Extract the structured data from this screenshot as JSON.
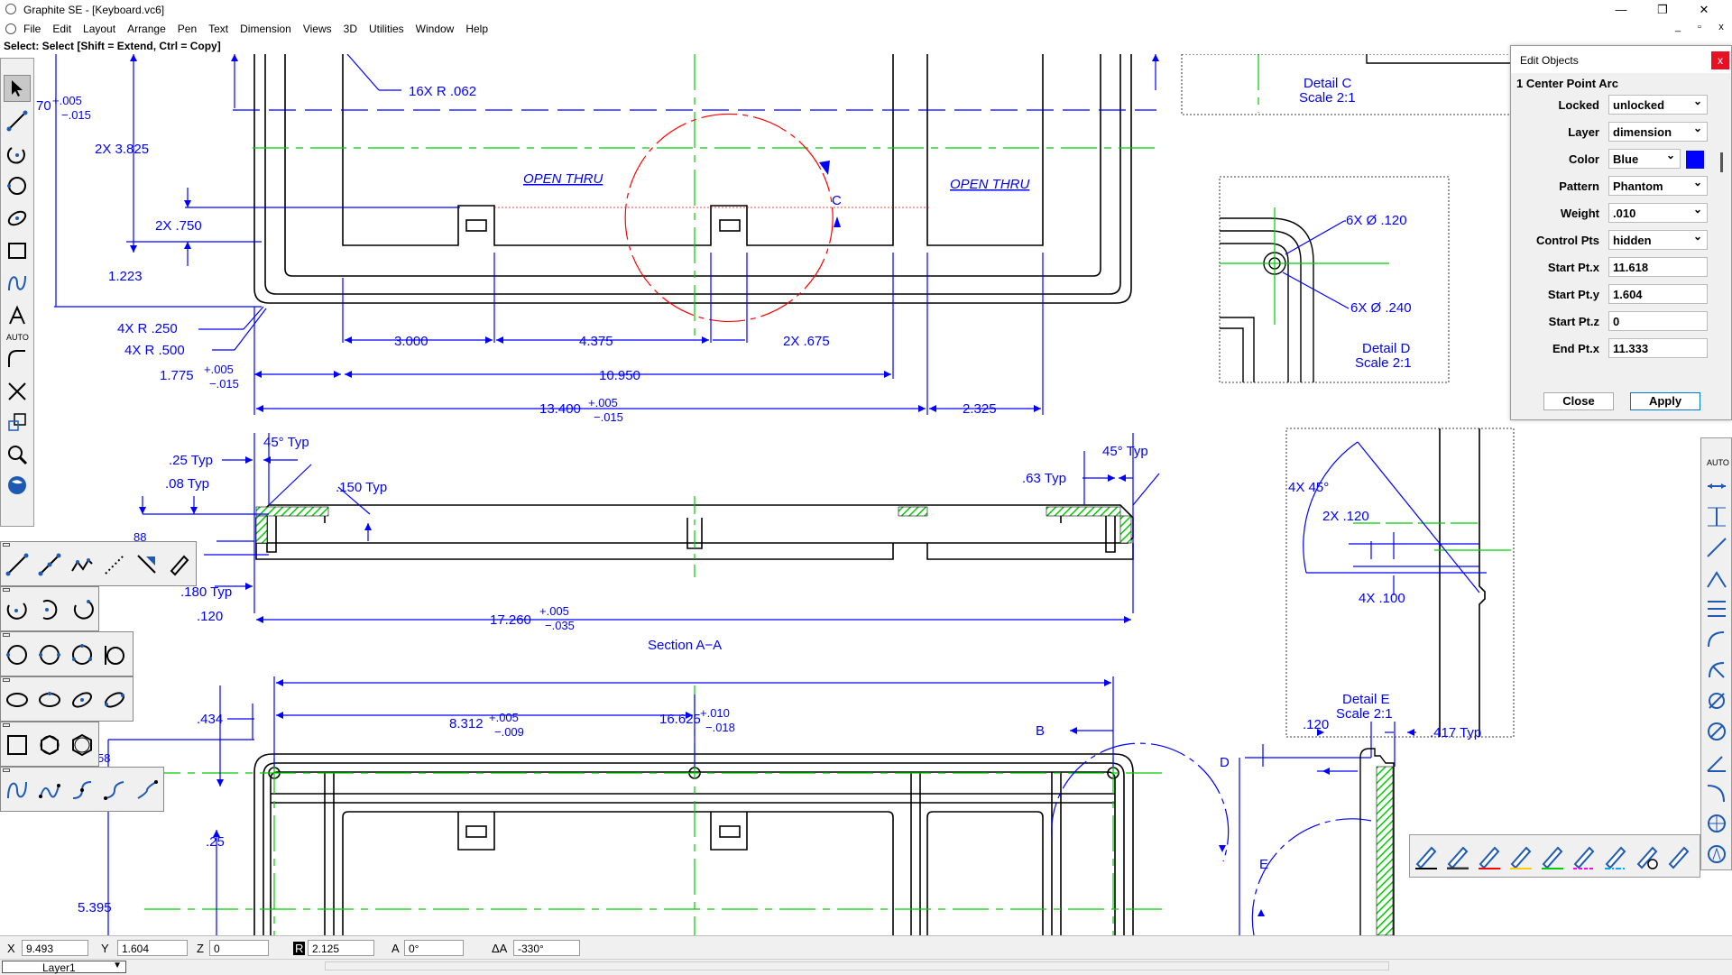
{
  "window": {
    "title": "Graphite SE - [Keyboard.vc6]",
    "minimize": "—",
    "maximize": "❐",
    "close": "✕",
    "doc_minimize": "_",
    "doc_restore": "▫",
    "doc_close": "x"
  },
  "menu": [
    "File",
    "Edit",
    "Layout",
    "Arrange",
    "Pen",
    "Text",
    "Dimension",
    "Views",
    "3D",
    "Utilities",
    "Window",
    "Help"
  ],
  "prompt": "Select: Select  [Shift = Extend, Ctrl = Copy]",
  "colors": {
    "dimension": "#0000ff",
    "centerline": "#00cc00",
    "geometry": "#000000",
    "selected": "#ff0000",
    "hatch": "#00cc00"
  },
  "drawing": {
    "tol_top": "70",
    "tol_top_plus": "+.005",
    "tol_top_minus": "−.015",
    "dim_16x": "16X   R .062",
    "dim_2x3825": "2X  3.825",
    "dim_2x750": "2X  .750",
    "dim_1223": "1.223",
    "dim_4xr250": "4X   R .250",
    "dim_4xr500": "4X   R .500",
    "dim_1775": "1.775",
    "dim_1775_plus": "+.005",
    "dim_1775_minus": "−.015",
    "dim_3000": "3.000",
    "dim_4375": "4.375",
    "dim_2x675": "2X  .675",
    "dim_10950": "10.950",
    "dim_13400": "13.400",
    "dim_13400_plus": "+.005",
    "dim_13400_minus": "−.015",
    "dim_2325": "2.325",
    "open_thru_1": "OPEN  THRU",
    "open_thru_2": "OPEN  THRU",
    "label_c": "C",
    "detail_c": "Detail  C",
    "detail_c_scale": "Scale  2:1",
    "dim_6x120": "6X    Ø  .120",
    "dim_6x240": "6X    Ø  .240",
    "detail_d": "Detail  D",
    "detail_d_scale": "Scale  2:1",
    "dim_25typ": ".25  Typ",
    "dim_08typ": ".08  Typ",
    "dim_45typ_l": "45°  Typ",
    "dim_150typ": ".150  Typ",
    "dim_63typ": ".63  Typ",
    "dim_45typ_r": "45°  Typ",
    "dim_88": "88",
    "dim_180typ": ".180  Typ",
    "dim_120": ".120",
    "dim_17260": "17.260",
    "dim_17260_plus": "+.005",
    "dim_17260_minus": "−.035",
    "section_aa": "Section  A−A",
    "dim_4x45": "4X    45°",
    "dim_2x120": "2X  .120",
    "dim_4x100": "4X  .100",
    "detail_e": "Detail  E",
    "detail_e_scale": "Scale  2:1",
    "dim_16625": "16.625",
    "dim_16625_plus": "+.010",
    "dim_16625_minus": "−.018",
    "dim_434": ".434",
    "dim_8312": "8.312",
    "dim_8312_plus": "+.005",
    "dim_8312_minus": "−.009",
    "dim_58": "58",
    "dim_25": ".25",
    "dim_5395": "5.395",
    "label_b": "B",
    "label_d": "D",
    "label_e": "E",
    "dim_120b": ".120",
    "dim_417typ": ".417  Typ"
  },
  "tools": {
    "auto_label": "AUTO",
    "right_auto_label": "AUTO"
  },
  "edit_objects": {
    "title": "Edit Objects",
    "close_glyph": "x",
    "selection": "1 Center Point Arc",
    "fields": [
      {
        "label": "Locked",
        "value": "unlocked",
        "type": "dropdown"
      },
      {
        "label": "Layer",
        "value": "dimension",
        "type": "dropdown"
      },
      {
        "label": "Color",
        "value": "Blue",
        "type": "color",
        "swatch": "#0000ff"
      },
      {
        "label": "Pattern",
        "value": "Phantom",
        "type": "dropdown"
      },
      {
        "label": "Weight",
        "value": ".010",
        "type": "dropdown"
      },
      {
        "label": "Control Pts",
        "value": "hidden",
        "type": "dropdown"
      },
      {
        "label": "Start Pt.x",
        "value": "11.618",
        "type": "text"
      },
      {
        "label": "Start Pt.y",
        "value": "1.604",
        "type": "text"
      },
      {
        "label": "Start Pt.z",
        "value": "0",
        "type": "text"
      },
      {
        "label": "End Pt.x",
        "value": "11.333",
        "type": "text"
      }
    ],
    "close_button": "Close",
    "apply_button": "Apply"
  },
  "status": {
    "x_label": "X",
    "x_value": "9.493",
    "y_label": "Y",
    "y_value": "1.604",
    "z_label": "Z",
    "z_value": "0",
    "r_label": "R",
    "r_value": "2.125",
    "a_label": "A",
    "a_value": "0°",
    "da_label": "ΔA",
    "da_value": "-330°",
    "layer": "Layer1"
  }
}
